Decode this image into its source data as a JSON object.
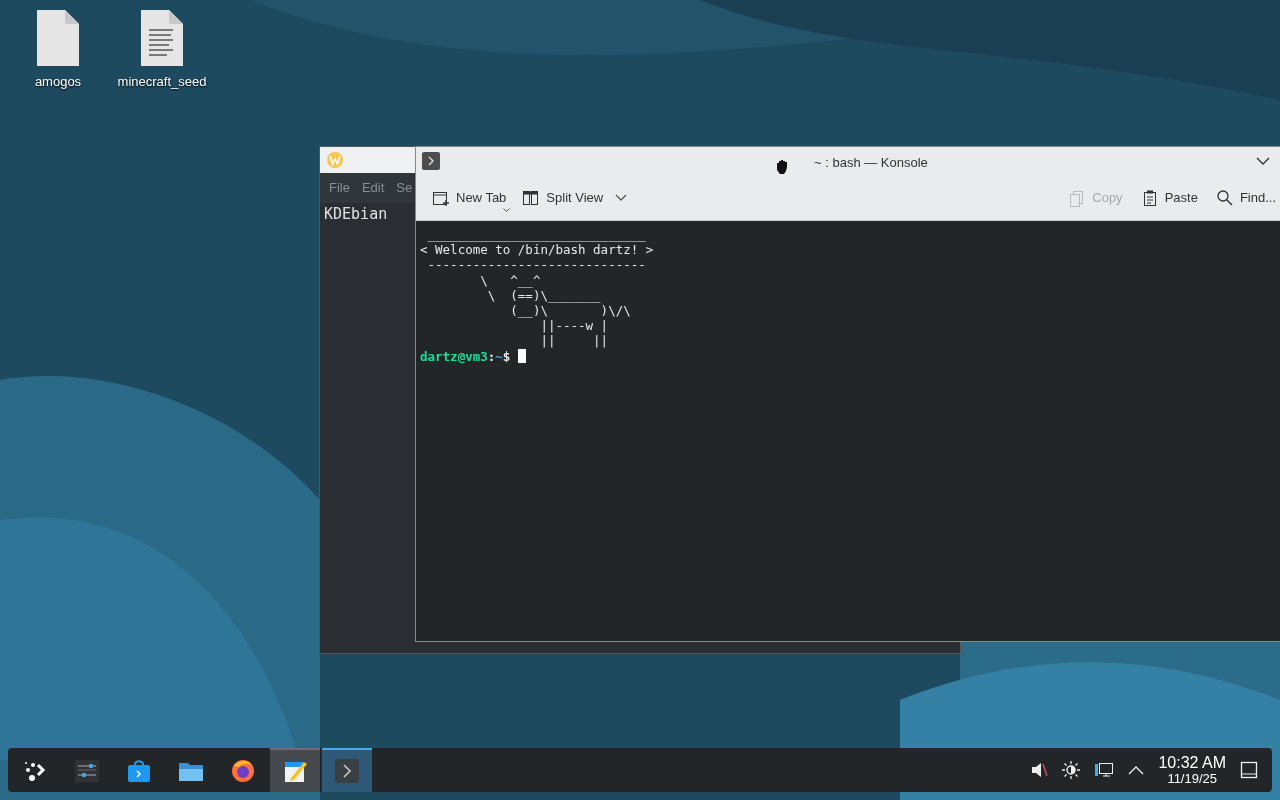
{
  "desktop_icons": [
    {
      "label": "amogos",
      "kind": "blank"
    },
    {
      "label": "minecraft_seed",
      "kind": "text"
    }
  ],
  "editor_window": {
    "menu": [
      "File",
      "Edit",
      "Se"
    ],
    "content": "KDEbian"
  },
  "konsole": {
    "title": "~ : bash — Konsole",
    "toolbar_left": [
      {
        "label": "New Tab",
        "kind": "new-tab",
        "disabled": false
      },
      {
        "label": "Split View",
        "kind": "split",
        "disabled": false
      }
    ],
    "toolbar_right": [
      {
        "label": "Copy",
        "kind": "copy",
        "disabled": true
      },
      {
        "label": "Paste",
        "kind": "paste",
        "disabled": false
      },
      {
        "label": "Find...",
        "kind": "find",
        "disabled": false
      }
    ],
    "output": [
      " _____________________________",
      "< Welcome to /bin/bash dartz! >",
      " -----------------------------",
      "        \\   ^__^",
      "         \\  (==)\\_______",
      "            (__)\\       )\\/\\",
      "                ||----w |",
      "                ||     ||"
    ],
    "prompt": {
      "user_host": "dartz@vm3",
      "separator": ":",
      "path": "~",
      "symbol": "$"
    }
  },
  "taskbar": {
    "items": [
      {
        "kind": "launcher",
        "open": false,
        "selected": false
      },
      {
        "kind": "settings",
        "open": false,
        "selected": false
      },
      {
        "kind": "store",
        "open": false,
        "selected": false
      },
      {
        "kind": "files",
        "open": false,
        "selected": false
      },
      {
        "kind": "browser",
        "open": false,
        "selected": false
      },
      {
        "kind": "editor",
        "open": true,
        "selected": false
      },
      {
        "kind": "terminal",
        "open": true,
        "selected": true
      }
    ],
    "tray": {
      "time": "10:32 AM",
      "date": "11/19/25"
    }
  }
}
